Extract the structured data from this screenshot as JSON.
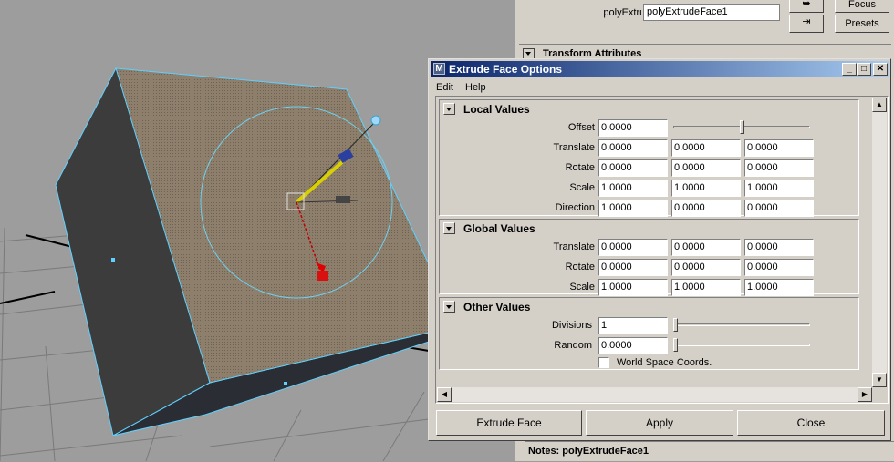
{
  "attribute_editor": {
    "node_label": "polyExtrudeFace:",
    "node_value": "polyExtrudeFace1",
    "focus_button": "Focus",
    "presets_button": "Presets",
    "section_title": "Transform Attributes",
    "notes": "Notes:  polyExtrudeFace1"
  },
  "dialog": {
    "title": "Extrude Face Options",
    "app_icon": "M",
    "menu": [
      "Edit",
      "Help"
    ],
    "local_values": {
      "title": "Local Values",
      "offset": {
        "label": "Offset",
        "value": "0.0000",
        "slider_fraction": 0.5
      },
      "translate": {
        "label": "Translate",
        "values": [
          "0.0000",
          "0.0000",
          "0.0000"
        ]
      },
      "rotate": {
        "label": "Rotate",
        "values": [
          "0.0000",
          "0.0000",
          "0.0000"
        ]
      },
      "scale": {
        "label": "Scale",
        "values": [
          "1.0000",
          "1.0000",
          "1.0000"
        ]
      },
      "direction": {
        "label": "Direction",
        "values": [
          "1.0000",
          "0.0000",
          "0.0000"
        ]
      }
    },
    "global_values": {
      "title": "Global Values",
      "translate": {
        "label": "Translate",
        "values": [
          "0.0000",
          "0.0000",
          "0.0000"
        ]
      },
      "rotate": {
        "label": "Rotate",
        "values": [
          "0.0000",
          "0.0000",
          "0.0000"
        ]
      },
      "scale": {
        "label": "Scale",
        "values": [
          "1.0000",
          "1.0000",
          "1.0000"
        ]
      }
    },
    "other_values": {
      "title": "Other Values",
      "divisions": {
        "label": "Divisions",
        "value": "1",
        "slider_fraction": 0.0
      },
      "random": {
        "label": "Random",
        "value": "0.0000",
        "slider_fraction": 0.0
      },
      "world_space": {
        "label": "World Space Coords.",
        "checked": false
      }
    },
    "buttons": {
      "extrude": "Extrude Face",
      "apply": "Apply",
      "close": "Close"
    }
  },
  "colors": {
    "face_fill": "#8f7f6a",
    "face_edge": "#5fd0ff",
    "side_dark": "#3b3b3b",
    "dialog_bg": "#d4d0c8",
    "title_bar": "#0a246a"
  }
}
